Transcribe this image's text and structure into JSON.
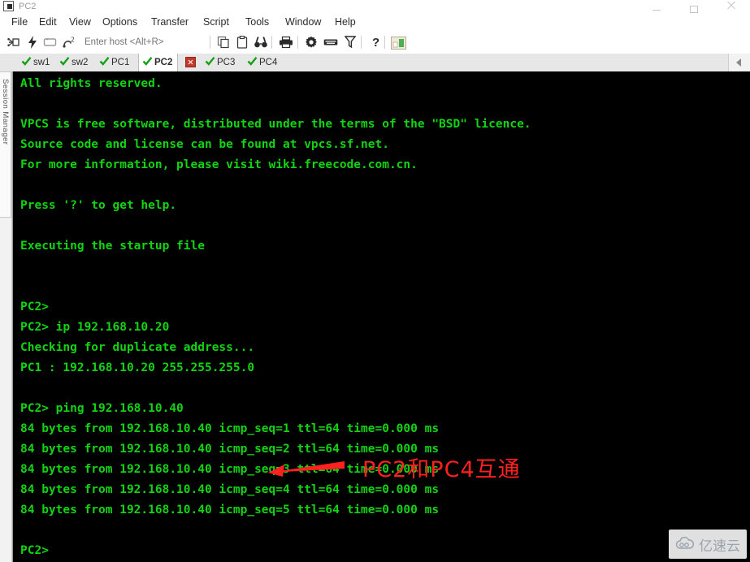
{
  "window": {
    "title": "PC2",
    "controls": {
      "minimize": "—",
      "maximize": "▢",
      "close": "✕"
    }
  },
  "menubar": {
    "items": [
      {
        "label": "File"
      },
      {
        "label": "Edit"
      },
      {
        "label": "View"
      },
      {
        "label": "Options"
      },
      {
        "label": "Transfer"
      },
      {
        "label": "Script"
      },
      {
        "label": "Tools"
      },
      {
        "label": "Window"
      },
      {
        "label": "Help"
      }
    ]
  },
  "toolbar": {
    "host_placeholder": "Enter host <Alt+R>",
    "host_value": "",
    "icons": [
      {
        "name": "connect-icon"
      },
      {
        "name": "quick-connect-icon"
      },
      {
        "name": "reconnect-icon"
      },
      {
        "name": "disconnect-icon"
      },
      {
        "name": "copy-icon"
      },
      {
        "name": "paste-icon"
      },
      {
        "name": "find-icon"
      },
      {
        "name": "print-icon"
      },
      {
        "name": "settings-gear-icon"
      },
      {
        "name": "keyboard-icon"
      },
      {
        "name": "filter-icon"
      },
      {
        "name": "help-question-icon"
      },
      {
        "name": "image-preview-icon"
      }
    ]
  },
  "tabs": {
    "items": [
      {
        "label": "sw1",
        "active": false
      },
      {
        "label": "sw2",
        "active": false
      },
      {
        "label": "PC1",
        "active": false
      },
      {
        "label": "PC2",
        "active": true
      },
      {
        "label": "PC3",
        "active": false
      },
      {
        "label": "PC4",
        "active": false
      }
    ],
    "scroll_left_label": "◀"
  },
  "sidebar": {
    "session_manager_label": "Session Manager"
  },
  "terminal": {
    "foreground_color": "#13d413",
    "background_color": "#000000",
    "lines": [
      "All rights reserved.",
      "",
      "VPCS is free software, distributed under the terms of the \"BSD\" licence.",
      "Source code and license can be found at vpcs.sf.net.",
      "For more information, please visit wiki.freecode.com.cn.",
      "",
      "Press '?' to get help.",
      "",
      "Executing the startup file",
      "",
      "",
      "PC2> ",
      "PC2> ip 192.168.10.20",
      "Checking for duplicate address...",
      "PC1 : 192.168.10.20 255.255.255.0",
      "",
      "PC2> ping 192.168.10.40",
      "84 bytes from 192.168.10.40 icmp_seq=1 ttl=64 time=0.000 ms",
      "84 bytes from 192.168.10.40 icmp_seq=2 ttl=64 time=0.000 ms",
      "84 bytes from 192.168.10.40 icmp_seq=3 ttl=64 time=0.000 ms",
      "84 bytes from 192.168.10.40 icmp_seq=4 ttl=64 time=0.000 ms",
      "84 bytes from 192.168.10.40 icmp_seq=5 ttl=64 time=0.000 ms",
      "",
      "PC2> "
    ]
  },
  "annotation": {
    "text": "PC2和PC4互通",
    "color": "#ff2020",
    "arrow_direction": "left"
  },
  "watermark": {
    "text": "亿速云"
  }
}
